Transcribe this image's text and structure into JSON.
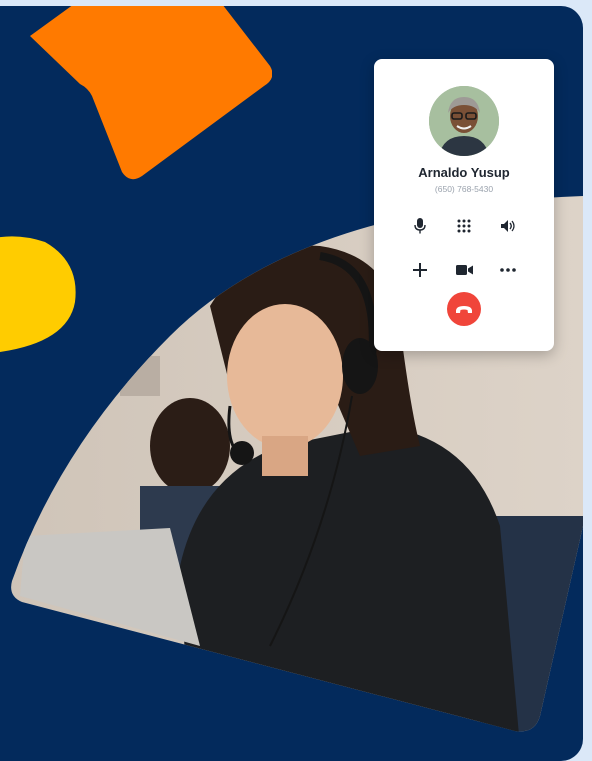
{
  "caller": {
    "name": "Arnaldo Yusup",
    "phone": "(650) 768-5430"
  },
  "controls": {
    "row1": [
      "microphone-icon",
      "keypad-icon",
      "speaker-icon"
    ],
    "row2": [
      "add-icon",
      "video-icon",
      "more-icon"
    ],
    "end": "end-call-icon"
  },
  "colors": {
    "panel": "#032a5c",
    "orange": "#ff7a00",
    "yellow": "#ffcc00",
    "end_call": "#f0453a",
    "background": "#dbe8f8"
  }
}
